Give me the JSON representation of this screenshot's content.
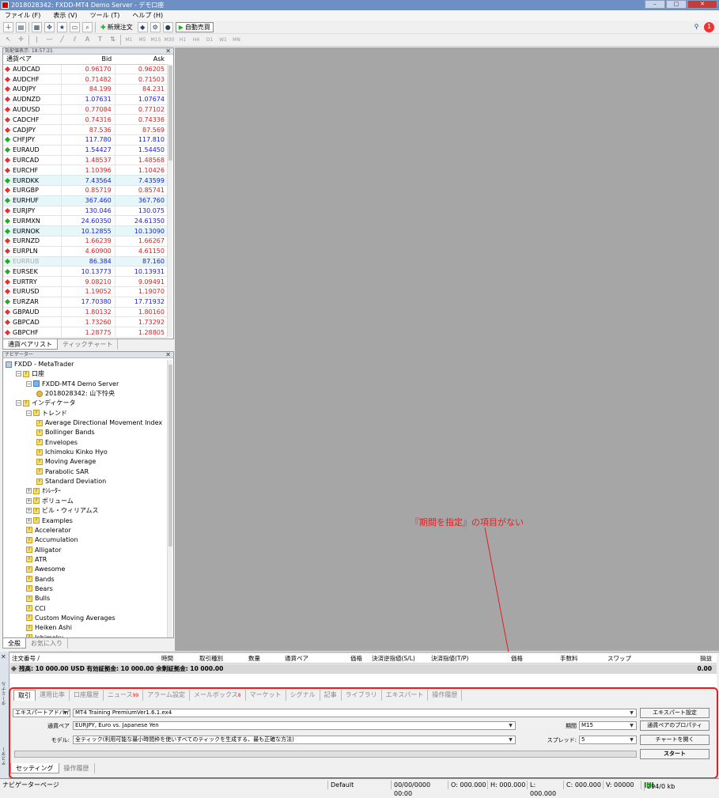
{
  "window": {
    "title": "2018028342: FXDD-MT4 Demo Server - デモ口座"
  },
  "menu": [
    "ファイル (F)",
    "表示 (V)",
    "ツール (T)",
    "ヘルプ (H)"
  ],
  "toolbar": {
    "new_order": "新規注文",
    "auto_trading": "自動売買"
  },
  "timeframes": [
    "M1",
    "M5",
    "M15",
    "M30",
    "H1",
    "H4",
    "D1",
    "W1",
    "MN"
  ],
  "notifications": {
    "count": "1"
  },
  "market_watch": {
    "title": "気配値表示: 18:57:21",
    "col_symbol": "通貨ペア",
    "col_bid": "Bid",
    "col_ask": "Ask",
    "rows": [
      {
        "sym": "AUDCAD",
        "bid": "0.96170",
        "ask": "0.96205",
        "c": "red",
        "dir": "dn",
        "hl": false
      },
      {
        "sym": "AUDCHF",
        "bid": "0.71482",
        "ask": "0.71503",
        "c": "red",
        "dir": "dn",
        "hl": false
      },
      {
        "sym": "AUDJPY",
        "bid": "84.199",
        "ask": "84.231",
        "c": "red",
        "dir": "dn",
        "hl": false
      },
      {
        "sym": "AUDNZD",
        "bid": "1.07631",
        "ask": "1.07674",
        "c": "blue",
        "dir": "dn",
        "hl": false
      },
      {
        "sym": "AUDUSD",
        "bid": "0.77084",
        "ask": "0.77102",
        "c": "red",
        "dir": "dn",
        "hl": false
      },
      {
        "sym": "CADCHF",
        "bid": "0.74316",
        "ask": "0.74336",
        "c": "red",
        "dir": "dn",
        "hl": false
      },
      {
        "sym": "CADJPY",
        "bid": "87.536",
        "ask": "87.569",
        "c": "red",
        "dir": "dn",
        "hl": false
      },
      {
        "sym": "CHFJPY",
        "bid": "117.780",
        "ask": "117.810",
        "c": "blue",
        "dir": "up",
        "hl": false
      },
      {
        "sym": "EURAUD",
        "bid": "1.54427",
        "ask": "1.54450",
        "c": "blue",
        "dir": "up",
        "hl": false
      },
      {
        "sym": "EURCAD",
        "bid": "1.48537",
        "ask": "1.48568",
        "c": "red",
        "dir": "dn",
        "hl": false
      },
      {
        "sym": "EURCHF",
        "bid": "1.10396",
        "ask": "1.10426",
        "c": "red",
        "dir": "dn",
        "hl": false
      },
      {
        "sym": "EURDKK",
        "bid": "7.43564",
        "ask": "7.43599",
        "c": "blue",
        "dir": "up",
        "hl": true
      },
      {
        "sym": "EURGBP",
        "bid": "0.85719",
        "ask": "0.85741",
        "c": "red",
        "dir": "dn",
        "hl": false
      },
      {
        "sym": "EURHUF",
        "bid": "367.460",
        "ask": "367.760",
        "c": "blue",
        "dir": "up",
        "hl": true
      },
      {
        "sym": "EURJPY",
        "bid": "130.046",
        "ask": "130.075",
        "c": "blue",
        "dir": "dn",
        "hl": false
      },
      {
        "sym": "EURMXN",
        "bid": "24.60350",
        "ask": "24.61350",
        "c": "blue",
        "dir": "up",
        "hl": false
      },
      {
        "sym": "EURNOK",
        "bid": "10.12855",
        "ask": "10.13090",
        "c": "blue",
        "dir": "up",
        "hl": true
      },
      {
        "sym": "EURNZD",
        "bid": "1.66239",
        "ask": "1.66267",
        "c": "red",
        "dir": "dn",
        "hl": false
      },
      {
        "sym": "EURPLN",
        "bid": "4.60900",
        "ask": "4.61150",
        "c": "red",
        "dir": "dn",
        "hl": false
      },
      {
        "sym": "EURRUB",
        "bid": "86.384",
        "ask": "87.160",
        "c": "blue",
        "dir": "up",
        "hl": true,
        "dim": true
      },
      {
        "sym": "EURSEK",
        "bid": "10.13773",
        "ask": "10.13931",
        "c": "blue",
        "dir": "up",
        "hl": false
      },
      {
        "sym": "EURTRY",
        "bid": "9.08210",
        "ask": "9.09491",
        "c": "red",
        "dir": "dn",
        "hl": false
      },
      {
        "sym": "EURUSD",
        "bid": "1.19052",
        "ask": "1.19070",
        "c": "red",
        "dir": "dn",
        "hl": false
      },
      {
        "sym": "EURZAR",
        "bid": "17.70380",
        "ask": "17.71932",
        "c": "blue",
        "dir": "up",
        "hl": false
      },
      {
        "sym": "GBPAUD",
        "bid": "1.80132",
        "ask": "1.80160",
        "c": "red",
        "dir": "dn",
        "hl": false
      },
      {
        "sym": "GBPCAD",
        "bid": "1.73260",
        "ask": "1.73292",
        "c": "red",
        "dir": "dn",
        "hl": false
      },
      {
        "sym": "GBPCHF",
        "bid": "1.28775",
        "ask": "1.28805",
        "c": "red",
        "dir": "dn",
        "hl": false
      }
    ],
    "tabs": [
      "通貨ペアリスト",
      "ティックチャート"
    ]
  },
  "navigator": {
    "title": "ナビゲーター",
    "nodes": [
      {
        "t": "FXDD - MetaTrader",
        "lvl": 0,
        "k": "root"
      },
      {
        "t": "口座",
        "lvl": 1,
        "k": "fold",
        "pm": "−"
      },
      {
        "t": "FXDD-MT4 Demo Server",
        "lvl": 2,
        "k": "srv",
        "pm": "−"
      },
      {
        "t": "2018028342: 山下怜央",
        "lvl": 3,
        "k": "acct"
      },
      {
        "t": "インディケータ",
        "lvl": 1,
        "k": "fold",
        "pm": "−"
      },
      {
        "t": "トレンド",
        "lvl": 2,
        "k": "fold",
        "pm": "−"
      },
      {
        "t": "Average Directional Movement Index",
        "lvl": 3,
        "k": "ind"
      },
      {
        "t": "Bollinger Bands",
        "lvl": 3,
        "k": "ind"
      },
      {
        "t": "Envelopes",
        "lvl": 3,
        "k": "ind"
      },
      {
        "t": "Ichimoku Kinko Hyo",
        "lvl": 3,
        "k": "ind"
      },
      {
        "t": "Moving Average",
        "lvl": 3,
        "k": "ind"
      },
      {
        "t": "Parabolic SAR",
        "lvl": 3,
        "k": "ind"
      },
      {
        "t": "Standard Deviation",
        "lvl": 3,
        "k": "ind"
      },
      {
        "t": "ｵｼﾚｰﾀｰ",
        "lvl": 2,
        "k": "fold",
        "pm": "+"
      },
      {
        "t": "ボリューム",
        "lvl": 2,
        "k": "fold",
        "pm": "+"
      },
      {
        "t": "ビル・ウィリアムス",
        "lvl": 2,
        "k": "fold",
        "pm": "+"
      },
      {
        "t": "Examples",
        "lvl": 2,
        "k": "fold",
        "pm": "+"
      },
      {
        "t": "Accelerator",
        "lvl": 2,
        "k": "ind"
      },
      {
        "t": "Accumulation",
        "lvl": 2,
        "k": "ind"
      },
      {
        "t": "Alligator",
        "lvl": 2,
        "k": "ind"
      },
      {
        "t": "ATR",
        "lvl": 2,
        "k": "ind"
      },
      {
        "t": "Awesome",
        "lvl": 2,
        "k": "ind"
      },
      {
        "t": "Bands",
        "lvl": 2,
        "k": "ind"
      },
      {
        "t": "Bears",
        "lvl": 2,
        "k": "ind"
      },
      {
        "t": "Bulls",
        "lvl": 2,
        "k": "ind"
      },
      {
        "t": "CCI",
        "lvl": 2,
        "k": "ind"
      },
      {
        "t": "Custom Moving Averages",
        "lvl": 2,
        "k": "ind"
      },
      {
        "t": "Heiken Ashi",
        "lvl": 2,
        "k": "ind"
      },
      {
        "t": "Ichimoku",
        "lvl": 2,
        "k": "ind"
      }
    ],
    "tabs": [
      "全般",
      "お気に入り"
    ]
  },
  "annotation": {
    "text": "『期間を指定』の項目がない"
  },
  "orders": {
    "headers": [
      "注文番号 /",
      "時間",
      "取引種別",
      "数量",
      "通貨ペア",
      "価格",
      "決済逆指値(S/L)",
      "決済指値(T/P)",
      "価格",
      "手数料",
      "スワップ",
      "損益"
    ],
    "balance": "残高: 10 000.00 USD  有効証拠金: 10 000.00  余剰証拠金: 10 000.00",
    "profit": "0.00"
  },
  "terminal_tabs": [
    {
      "label": "取引",
      "badge": ""
    },
    {
      "label": "運用比率",
      "badge": ""
    },
    {
      "label": "口座履歴",
      "badge": ""
    },
    {
      "label": "ニュース",
      "badge": "99"
    },
    {
      "label": "アラーム設定",
      "badge": ""
    },
    {
      "label": "メールボックス",
      "badge": "8"
    },
    {
      "label": "マーケット",
      "badge": ""
    },
    {
      "label": "シグナル",
      "badge": ""
    },
    {
      "label": "記事",
      "badge": ""
    },
    {
      "label": "ライブラリ",
      "badge": ""
    },
    {
      "label": "エキスパート",
      "badge": ""
    },
    {
      "label": "操作履歴",
      "badge": ""
    }
  ],
  "sidebar": {
    "terminal_label": "ターミナル",
    "tester_label": "テスター"
  },
  "tester": {
    "type_select": "エキスパートアドバイザ",
    "ea_file": "MT4 Training PremiumVer1.6.1.ex4",
    "symbol_label": "通貨ペア",
    "symbol_value": "EURJPY, Euro vs. Japanese Yen",
    "model_label": "モデル:",
    "model_value": "全ティック(利用可能な最小時間枠を使いすべてのティックを生成する、最も正確な方法)",
    "period_label": "期間",
    "period_value": "M15",
    "spread_label": "スプレッド:",
    "spread_value": "5",
    "btn_expert": "エキスパート設定",
    "btn_symbol": "通貨ペアのプロパティ",
    "btn_chart": "チャートを開く",
    "btn_start": "スタート",
    "tabs": [
      "セッティング",
      "操作履歴"
    ]
  },
  "statusbar": {
    "help": "ナビゲーターページ",
    "profile": "Default",
    "datetime": "00/00/0000 00:00",
    "open": "O: 000.000",
    "high": "H: 000.000",
    "low": "L: 000.000",
    "close": "C: 000.000",
    "volume": "V: 00000",
    "traffic": "294/0 kb"
  },
  "colors": {
    "up": "#1a1ad6",
    "down": "#e02020",
    "chart_bg": "#a6a6a6",
    "annotation": "#e02020"
  }
}
